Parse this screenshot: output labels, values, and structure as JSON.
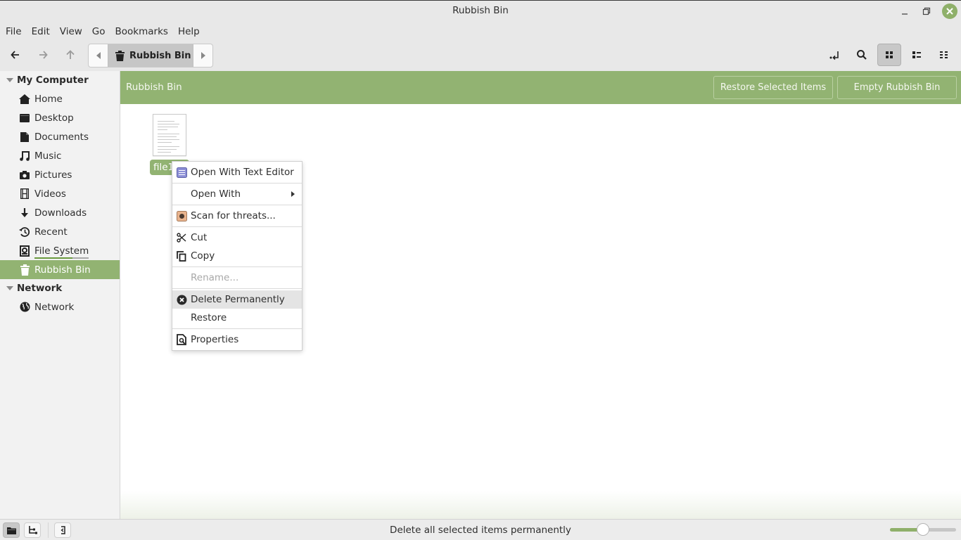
{
  "window": {
    "title": "Rubbish Bin"
  },
  "menubar": {
    "items": [
      "File",
      "Edit",
      "View",
      "Go",
      "Bookmarks",
      "Help"
    ]
  },
  "toolbar": {
    "back_icon": "arrow-left-icon",
    "forward_icon": "arrow-right-icon",
    "up_icon": "arrow-up-icon",
    "path_crumb": "Rubbish Bin",
    "view_mode_active": "icon-view"
  },
  "sidebar": {
    "sections": [
      {
        "title": "My Computer",
        "items": [
          {
            "label": "Home",
            "icon": "home-icon"
          },
          {
            "label": "Desktop",
            "icon": "desktop-icon"
          },
          {
            "label": "Documents",
            "icon": "document-icon"
          },
          {
            "label": "Music",
            "icon": "music-icon"
          },
          {
            "label": "Pictures",
            "icon": "camera-icon"
          },
          {
            "label": "Videos",
            "icon": "film-icon"
          },
          {
            "label": "Downloads",
            "icon": "download-icon"
          },
          {
            "label": "Recent",
            "icon": "history-icon"
          },
          {
            "label": "File System",
            "icon": "drive-icon",
            "usage_fraction": 0.7
          },
          {
            "label": "Rubbish Bin",
            "icon": "trash-icon",
            "active": true
          }
        ]
      },
      {
        "title": "Network",
        "items": [
          {
            "label": "Network",
            "icon": "globe-icon"
          }
        ]
      }
    ]
  },
  "infobar": {
    "label": "Rubbish Bin",
    "restore_button": "Restore Selected Items",
    "empty_button": "Empty Rubbish Bin"
  },
  "files": [
    {
      "name": "file1",
      "selected": true
    }
  ],
  "context_menu": {
    "open_with_text_editor": "Open With Text Editor",
    "open_with": "Open With",
    "scan": "Scan for threats...",
    "cut": "Cut",
    "copy": "Copy",
    "rename": "Rename...",
    "delete_permanently": "Delete Permanently",
    "restore": "Restore",
    "properties": "Properties"
  },
  "statusbar": {
    "text": "Delete all selected items permanently",
    "zoom_level_fraction": 0.5
  }
}
